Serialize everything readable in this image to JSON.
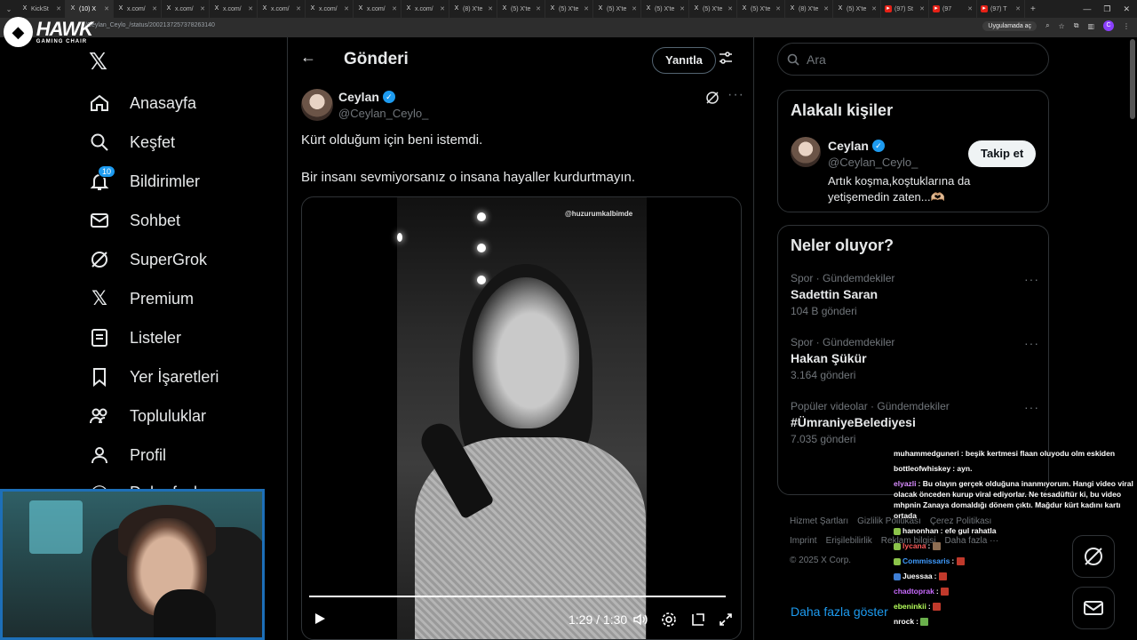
{
  "browser": {
    "tabs": [
      {
        "label": "KickSt",
        "active": false
      },
      {
        "label": "(10) X",
        "active": true
      },
      {
        "label": "x.com/",
        "active": false
      },
      {
        "label": "x.com/",
        "active": false
      },
      {
        "label": "x.com/",
        "active": false
      },
      {
        "label": "x.com/",
        "active": false
      },
      {
        "label": "x.com/",
        "active": false
      },
      {
        "label": "x.com/",
        "active": false
      },
      {
        "label": "x.com/",
        "active": false
      },
      {
        "label": "(8) X'te",
        "active": false
      },
      {
        "label": "(5) X'te",
        "active": false
      },
      {
        "label": "(5) X'te",
        "active": false
      },
      {
        "label": "(5) X'te",
        "active": false
      },
      {
        "label": "(5) X'te",
        "active": false
      },
      {
        "label": "(5) X'te",
        "active": false
      },
      {
        "label": "(5) X'te",
        "active": false
      },
      {
        "label": "(8) X'te",
        "active": false
      },
      {
        "label": "(5) X'te",
        "active": false
      },
      {
        "label": "(97) St",
        "active": false
      },
      {
        "label": "(97",
        "active": false
      },
      {
        "label": "(97) T",
        "active": false
      }
    ],
    "url": "/Ceylan_Ceylo_/status/2002137257378263140",
    "open_in_app": "Uygulamada aç",
    "profile_initial": "C"
  },
  "brand": {
    "name": "HAWK",
    "tagline": "GAMING CHAIR"
  },
  "nav": {
    "items": [
      {
        "label": "Anasayfa",
        "icon": "home-icon"
      },
      {
        "label": "Keşfet",
        "icon": "search-icon"
      },
      {
        "label": "Bildirimler",
        "icon": "bell-icon",
        "badge": "10"
      },
      {
        "label": "Sohbet",
        "icon": "mail-icon"
      },
      {
        "label": "SuperGrok",
        "icon": "grok-icon"
      },
      {
        "label": "Premium",
        "icon": "x-icon"
      },
      {
        "label": "Listeler",
        "icon": "list-icon"
      },
      {
        "label": "Yer İşaretleri",
        "icon": "bookmark-icon"
      },
      {
        "label": "Topluluklar",
        "icon": "people-icon"
      },
      {
        "label": "Profil",
        "icon": "person-icon"
      }
    ],
    "more_partial": "Daha fazla"
  },
  "header": {
    "title": "Gönderi",
    "reply_label": "Yanıtla"
  },
  "post": {
    "name": "Ceylan",
    "handle": "@Ceylan_Ceylo_",
    "text1": "Kürt olduğum için beni istemdi.",
    "text2": "Bir insanı sevmiyorsanız o insana hayaller kurdurtmayın.",
    "video": {
      "watermark": "@huzurumkalbimde",
      "time": "1:29 / 1:30",
      "progress": 0.99
    }
  },
  "search": {
    "placeholder": "Ara"
  },
  "related": {
    "title": "Alakalı kişiler",
    "name": "Ceylan",
    "handle": "@Ceylan_Ceylo_",
    "bio": "Artık koşma,koştuklarına da yetişemedin zaten...🫶🏼",
    "follow_label": "Takip et"
  },
  "trends": {
    "title": "Neler oluyor?",
    "items": [
      {
        "meta": "Spor · Gündemdekiler",
        "name": "Sadettin Saran",
        "count": "104 B gönderi"
      },
      {
        "meta": "Spor · Gündemdekiler",
        "name": "Hakan Şükür",
        "count": "3.164 gönderi"
      },
      {
        "meta": "Popüler videolar · Gündemdekiler",
        "name": "#ÜmraniyeBelediyesi",
        "count": "7.035 gönderi"
      }
    ],
    "show_more": "Daha fazla göster"
  },
  "footer": {
    "links": [
      "Hizmet Şartları",
      "Gizlilik Politikası",
      "Çerez Politikası",
      "Imprint",
      "Erişilebilirlik",
      "Reklam bilgisi",
      "Daha fazla ···"
    ],
    "copyright": "© 2025 X Corp."
  },
  "chat": [
    {
      "user": "muhammedguneri",
      "color": "#ffffff",
      "text": ": beşik kertmesi flaan oluyodu olm eskiden"
    },
    {
      "user": "bottleofwhiskey",
      "color": "#ffffff",
      "text": ": ayn."
    },
    {
      "user": "elyazli",
      "color": "#d98cff",
      "text": ": Bu olayın gerçek olduğuna inanmıyorum. Hangi video viral olacak önceden kurup viral ediyorlar. Ne tesadüftür ki, bu video mhpnin Zanaya domaldığı dönem çıktı. Mağdur kürt kadını kartı ortada"
    },
    {
      "user": "hanonhan",
      "color": "#ffffff",
      "text": ": efe gul rahatla"
    },
    {
      "user": "lycana",
      "color": "#ff5b5b",
      "text": ":"
    },
    {
      "user": "Commissaris",
      "color": "#3f9cff",
      "text": ":"
    },
    {
      "user": "Juessaa",
      "color": "#ffffff",
      "text": ":"
    },
    {
      "user": "chadtoprak",
      "color": "#c96bff",
      "text": ":"
    },
    {
      "user": "ebeninkii",
      "color": "#b5ff5b",
      "text": ":"
    },
    {
      "user": "nrock",
      "color": "#ffffff",
      "text": ":"
    }
  ],
  "colors": {
    "accent": "#1d9bf0",
    "border": "#2f3336",
    "muted": "#71767b"
  }
}
